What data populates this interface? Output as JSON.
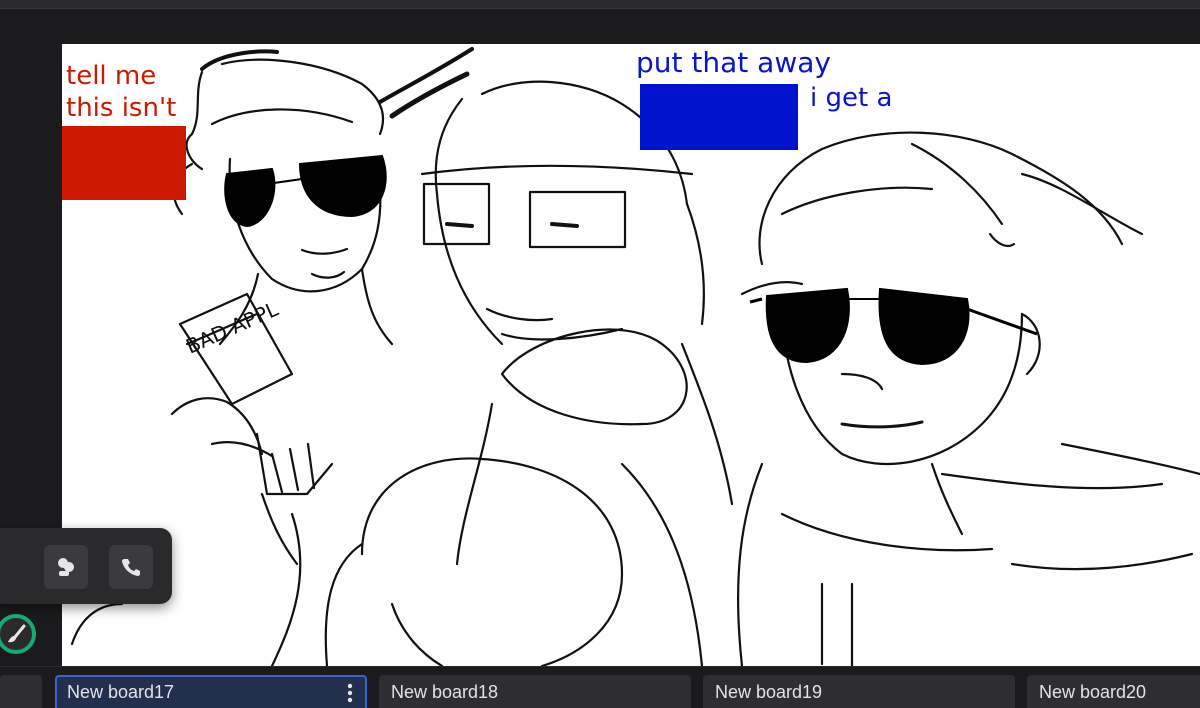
{
  "canvas": {
    "annotations": {
      "red_note": "tell me\nthis isn't",
      "blue_note": "put that away\ni get a",
      "can_label": "BAD APPL"
    },
    "colors": {
      "red_mark": "#cc1a00",
      "blue_mark": "#0012cc",
      "ink": "#111111"
    }
  },
  "call_panel": {
    "huddle_icon": "huddle-icon",
    "phone_icon": "phone-icon"
  },
  "brush": {
    "icon": "brush-icon",
    "ring_color": "#19a974"
  },
  "tabs": [
    {
      "label": ""
    },
    {
      "label": "New board17",
      "active": true
    },
    {
      "label": "New board18"
    },
    {
      "label": "New board19"
    },
    {
      "label": "New board20"
    }
  ],
  "theme": {
    "accent": "#3f63c9",
    "background": "#1b1b1d"
  }
}
